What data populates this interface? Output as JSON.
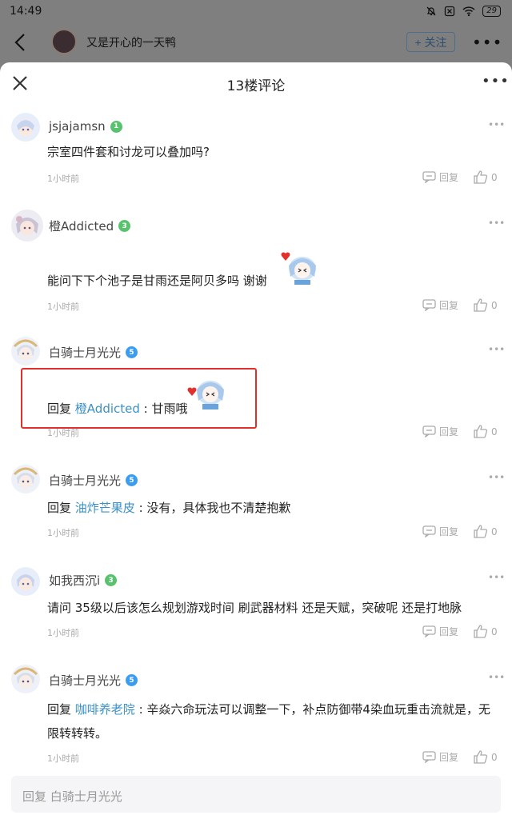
{
  "status_bar": {
    "time": "14:49",
    "battery": "29"
  },
  "background": {
    "title": "又是开心的一天鸭",
    "follow_label": "+ 关注"
  },
  "sheet": {
    "title": "13楼评论",
    "reply_placeholder": "回复 白骑士月光光"
  },
  "comments": [
    {
      "user": "jsjajamsn",
      "level": "1",
      "text": "宗室四件套和讨龙可以叠加吗?",
      "time": "1小时前",
      "reply_label": "回复",
      "likes": "0"
    },
    {
      "user": "橙Addicted",
      "level": "3",
      "text": "能问下下个池子是甘雨还是阿贝多吗 谢谢",
      "time": "1小时前",
      "reply_label": "回复",
      "likes": "0"
    },
    {
      "user": "白骑士月光光",
      "level": "5",
      "reply_prefix": "回复",
      "reply_to": "橙Addicted",
      "text": " : 甘雨哦",
      "time": "1小时前",
      "reply_label": "回复",
      "likes": "0"
    },
    {
      "user": "白骑士月光光",
      "level": "5",
      "reply_prefix": "回复",
      "reply_to": "油炸芒果皮",
      "text": " : 没有，具体我也不清楚抱歉",
      "time": "1小时前",
      "reply_label": "回复",
      "likes": "0"
    },
    {
      "user": "如我西沉i",
      "level": "3",
      "text": "请问 35级以后该怎么规划游戏时间 刷武器材料 还是天赋，突破呢 还是打地脉",
      "time": "1小时前",
      "reply_label": "回复",
      "likes": "0"
    },
    {
      "user": "白骑士月光光",
      "level": "5",
      "reply_prefix": "回复",
      "reply_to": "咖啡养老院",
      "text": " : 辛焱六命玩法可以调整一下，补点防御带4染血玩重击流就是，无限转转转。",
      "time": "1小时前",
      "reply_label": "回复",
      "likes": "0"
    }
  ],
  "colors": {
    "accent_link": "#3a91c7",
    "level_green": "#58c26e",
    "level_blue": "#3b9df2",
    "highlight": "#e0302c"
  }
}
